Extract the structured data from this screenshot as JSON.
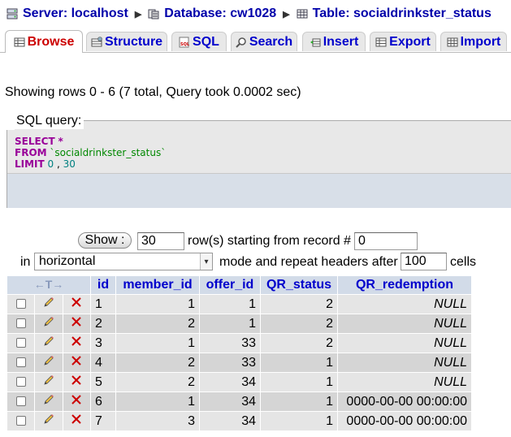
{
  "breadcrumb": {
    "server_label": "Server: localhost",
    "database_label": "Database: cw1028",
    "table_label": "Table: socialdrinkster_status",
    "server_icon": "server-icon",
    "database_icon": "database-icon",
    "table_icon": "table-icon",
    "separator": "▶"
  },
  "tabs": [
    {
      "label": "Browse",
      "icon": "browse-icon",
      "active": true
    },
    {
      "label": "Structure",
      "icon": "structure-icon",
      "active": false
    },
    {
      "label": "SQL",
      "icon": "sql-icon",
      "active": false
    },
    {
      "label": "Search",
      "icon": "search-icon",
      "active": false
    },
    {
      "label": "Insert",
      "icon": "insert-icon",
      "active": false
    },
    {
      "label": "Export",
      "icon": "export-icon",
      "active": false
    },
    {
      "label": "Import",
      "icon": "import-icon",
      "active": false
    }
  ],
  "info": {
    "text": "Showing rows 0 - 6 (7 total, Query took 0.0002 sec)"
  },
  "sql": {
    "legend": "SQL query:",
    "select_kw": "SELECT",
    "star": "*",
    "from_kw": "FROM",
    "table": "`socialdrinkster_status`",
    "limit_kw": "LIMIT",
    "limit_start": "0",
    "limit_sep": ",",
    "limit_count": "30"
  },
  "nav": {
    "show_button": "Show :",
    "rows_value": "30",
    "rows_label": "row(s) starting from record #",
    "start_value": "0",
    "in_label": "in",
    "mode_value": "horizontal",
    "mode_label": "mode and repeat headers after",
    "repeat_value": "100",
    "cells_label": "cells"
  },
  "table": {
    "sort_arrows": "←T→",
    "columns": [
      "id",
      "member_id",
      "offer_id",
      "QR_status",
      "QR_redemption"
    ],
    "rows": [
      {
        "id": "1",
        "member_id": "1",
        "offer_id": "1",
        "QR_status": "2",
        "QR_redemption": "NULL"
      },
      {
        "id": "2",
        "member_id": "2",
        "offer_id": "1",
        "QR_status": "2",
        "QR_redemption": "NULL"
      },
      {
        "id": "3",
        "member_id": "1",
        "offer_id": "33",
        "QR_status": "2",
        "QR_redemption": "NULL"
      },
      {
        "id": "4",
        "member_id": "2",
        "offer_id": "33",
        "QR_status": "1",
        "QR_redemption": "NULL"
      },
      {
        "id": "5",
        "member_id": "2",
        "offer_id": "34",
        "QR_status": "1",
        "QR_redemption": "NULL"
      },
      {
        "id": "6",
        "member_id": "1",
        "offer_id": "34",
        "QR_status": "1",
        "QR_redemption": "0000-00-00 00:00:00"
      },
      {
        "id": "7",
        "member_id": "3",
        "offer_id": "34",
        "QR_status": "1",
        "QR_redemption": "0000-00-00 00:00:00"
      }
    ],
    "edit_icon": "pencil-icon",
    "delete_icon": "delete-x-icon"
  },
  "colors": {
    "link_blue": "#0000aa",
    "active_tab_red": "#cc0000",
    "header_bg": "#d2dbe8",
    "row_light": "#e5e5e5",
    "row_dark": "#d5d5d5",
    "sql_keyword": "#990099",
    "sql_table": "#008800",
    "delete_red": "#cc0000"
  }
}
